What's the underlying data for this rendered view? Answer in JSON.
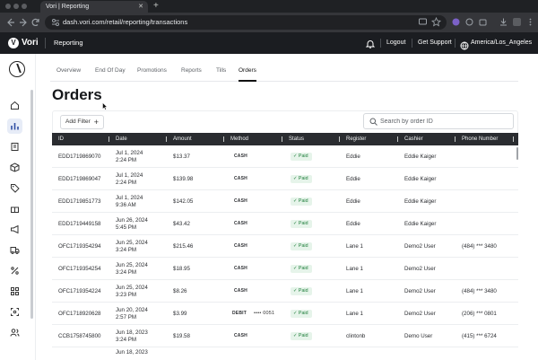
{
  "browser": {
    "tab_title": "Vori | Reporting",
    "tab_close_glyph": "✕",
    "new_tab_glyph": "+",
    "url": "dash.vori.com/retail/reporting/transactions"
  },
  "app": {
    "logo_glyph": "V",
    "logo": "Vori",
    "section": "Reporting",
    "logout": "Logout",
    "get_support": "Get Support",
    "timezone": "America/Los_Angeles"
  },
  "sidebar": {
    "items": [
      {
        "name": "home-icon",
        "active": false
      },
      {
        "name": "chart-icon",
        "active": true
      },
      {
        "name": "receipt-icon",
        "active": false
      },
      {
        "name": "box-icon",
        "active": false
      },
      {
        "name": "tag-icon",
        "active": false
      },
      {
        "name": "gift-icon",
        "active": false
      },
      {
        "name": "megaphone-icon",
        "active": false
      },
      {
        "name": "truck-icon",
        "active": false
      },
      {
        "name": "percent-icon",
        "active": false
      },
      {
        "name": "grid-icon",
        "active": false
      },
      {
        "name": "scan-icon",
        "active": false
      },
      {
        "name": "users-icon",
        "active": false
      }
    ]
  },
  "subnav": {
    "tabs": [
      {
        "label": "Overview",
        "active": false
      },
      {
        "label": "End Of Day",
        "active": false
      },
      {
        "label": "Promotions",
        "active": false
      },
      {
        "label": "Reports",
        "active": false
      },
      {
        "label": "Tills",
        "active": false
      },
      {
        "label": "Orders",
        "active": true
      }
    ]
  },
  "page": {
    "title": "Orders",
    "add_filter": "Add Filter",
    "add_filter_glyph": "+",
    "search_placeholder": "Search by order ID"
  },
  "table": {
    "columns": [
      "ID",
      "Date",
      "Amount",
      "Method",
      "Status",
      "Register",
      "Cashier",
      "Phone Number"
    ],
    "rows": [
      {
        "id": "EDD1719869070",
        "date": "Jul 1, 2024",
        "time": "2:24 PM",
        "amount": "$13.37",
        "method": "CASH",
        "card": "",
        "status": "Paid",
        "register": "Eddie",
        "cashier": "Eddie Kaiger",
        "phone": ""
      },
      {
        "id": "EDD1719869047",
        "date": "Jul 1, 2024",
        "time": "2:24 PM",
        "amount": "$139.98",
        "method": "CASH",
        "card": "",
        "status": "Paid",
        "register": "Eddie",
        "cashier": "Eddie Kaiger",
        "phone": ""
      },
      {
        "id": "EDD1719851773",
        "date": "Jul 1, 2024",
        "time": "9:36 AM",
        "amount": "$142.05",
        "method": "CASH",
        "card": "",
        "status": "Paid",
        "register": "Eddie",
        "cashier": "Eddie Kaiger",
        "phone": ""
      },
      {
        "id": "EDD1719449158",
        "date": "Jun 26, 2024",
        "time": "5:45 PM",
        "amount": "$43.42",
        "method": "CASH",
        "card": "",
        "status": "Paid",
        "register": "Eddie",
        "cashier": "Eddie Kaiger",
        "phone": ""
      },
      {
        "id": "OFC1719354294",
        "date": "Jun 25, 2024",
        "time": "3:24 PM",
        "amount": "$215.46",
        "method": "CASH",
        "card": "",
        "status": "Paid",
        "register": "Lane 1",
        "cashier": "Demo2 User",
        "phone": "(484) *** 3480"
      },
      {
        "id": "OFC1719354254",
        "date": "Jun 25, 2024",
        "time": "3:24 PM",
        "amount": "$18.95",
        "method": "CASH",
        "card": "",
        "status": "Paid",
        "register": "Lane 1",
        "cashier": "Demo2 User",
        "phone": ""
      },
      {
        "id": "OFC1719354224",
        "date": "Jun 25, 2024",
        "time": "3:23 PM",
        "amount": "$8.26",
        "method": "CASH",
        "card": "",
        "status": "Paid",
        "register": "Lane 1",
        "cashier": "Demo2 User",
        "phone": "(484) *** 3480"
      },
      {
        "id": "OFC1718920628",
        "date": "Jun 20, 2024",
        "time": "2:57 PM",
        "amount": "$3.99",
        "method": "DEBIT",
        "card": "•••• 0051",
        "status": "Paid",
        "register": "Lane 1",
        "cashier": "Demo2 User",
        "phone": "(206) *** 0801"
      },
      {
        "id": "CCB1758745800",
        "date": "Jun 18, 2023",
        "time": "3:24 PM",
        "amount": "$19.58",
        "method": "CASH",
        "card": "",
        "status": "Paid",
        "register": "clintonb",
        "cashier": "Demo User",
        "phone": "(415) *** 6724"
      },
      {
        "id": "",
        "date": "Jun 18, 2023",
        "time": "",
        "amount": "",
        "method": "",
        "card": "",
        "status": "",
        "register": "",
        "cashier": "",
        "phone": ""
      }
    ]
  }
}
